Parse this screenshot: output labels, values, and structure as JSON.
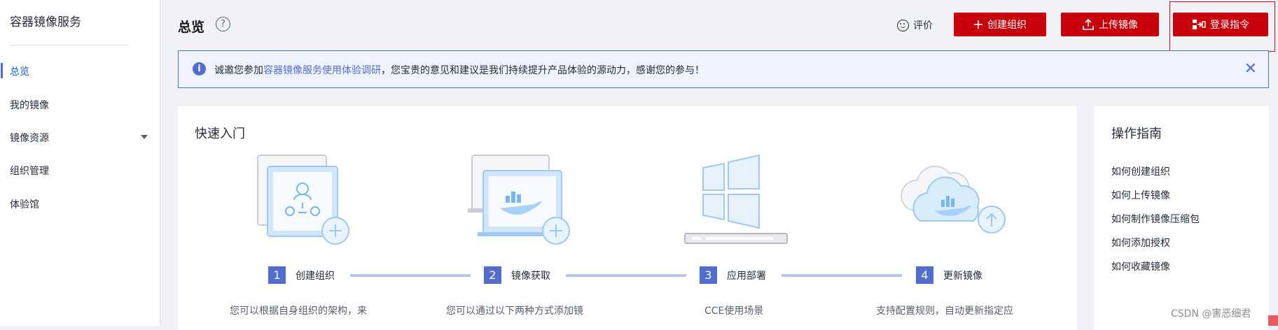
{
  "sidebar": {
    "title": "容器镜像服务",
    "items": [
      {
        "label": "总览"
      },
      {
        "label": "我的镜像"
      },
      {
        "label": "镜像资源"
      },
      {
        "label": "组织管理"
      },
      {
        "label": "体验馆"
      }
    ]
  },
  "header": {
    "title": "总览",
    "help_icon": "?",
    "rate_label": "评价",
    "create_org_label": "创建组织",
    "upload_image_label": "上传镜像",
    "login_cmd_label": "登录指令"
  },
  "notice": {
    "icon": "i",
    "prefix": "诚邀您参加",
    "link": "容器镜像服务使用体验调研",
    "suffix": "，您宝贵的意见和建议是我们持续提升产品体验的源动力，感谢您的参与！",
    "close": "✕"
  },
  "quick_start": {
    "title": "快速入门",
    "steps": [
      {
        "num": "1",
        "label": "创建组织",
        "desc": "您可以根据自身组织的架构，来"
      },
      {
        "num": "2",
        "label": "镜像获取",
        "desc": "您可以通过以下两种方式添加镜"
      },
      {
        "num": "3",
        "label": "应用部署",
        "desc": "CCE使用场景"
      },
      {
        "num": "4",
        "label": "更新镜像",
        "desc": "支持配置规则，自动更新指定应"
      }
    ]
  },
  "guide": {
    "title": "操作指南",
    "links": [
      {
        "label": "如何创建组织"
      },
      {
        "label": "如何上传镜像"
      },
      {
        "label": "如何制作镜像压缩包"
      },
      {
        "label": "如何添加授权"
      },
      {
        "label": "如何收藏镜像"
      }
    ]
  },
  "watermark": "CSDN @害恶细君",
  "colors": {
    "accent": "#526ecc",
    "brand_red": "#c7000b",
    "highlight": "#e0001b"
  }
}
